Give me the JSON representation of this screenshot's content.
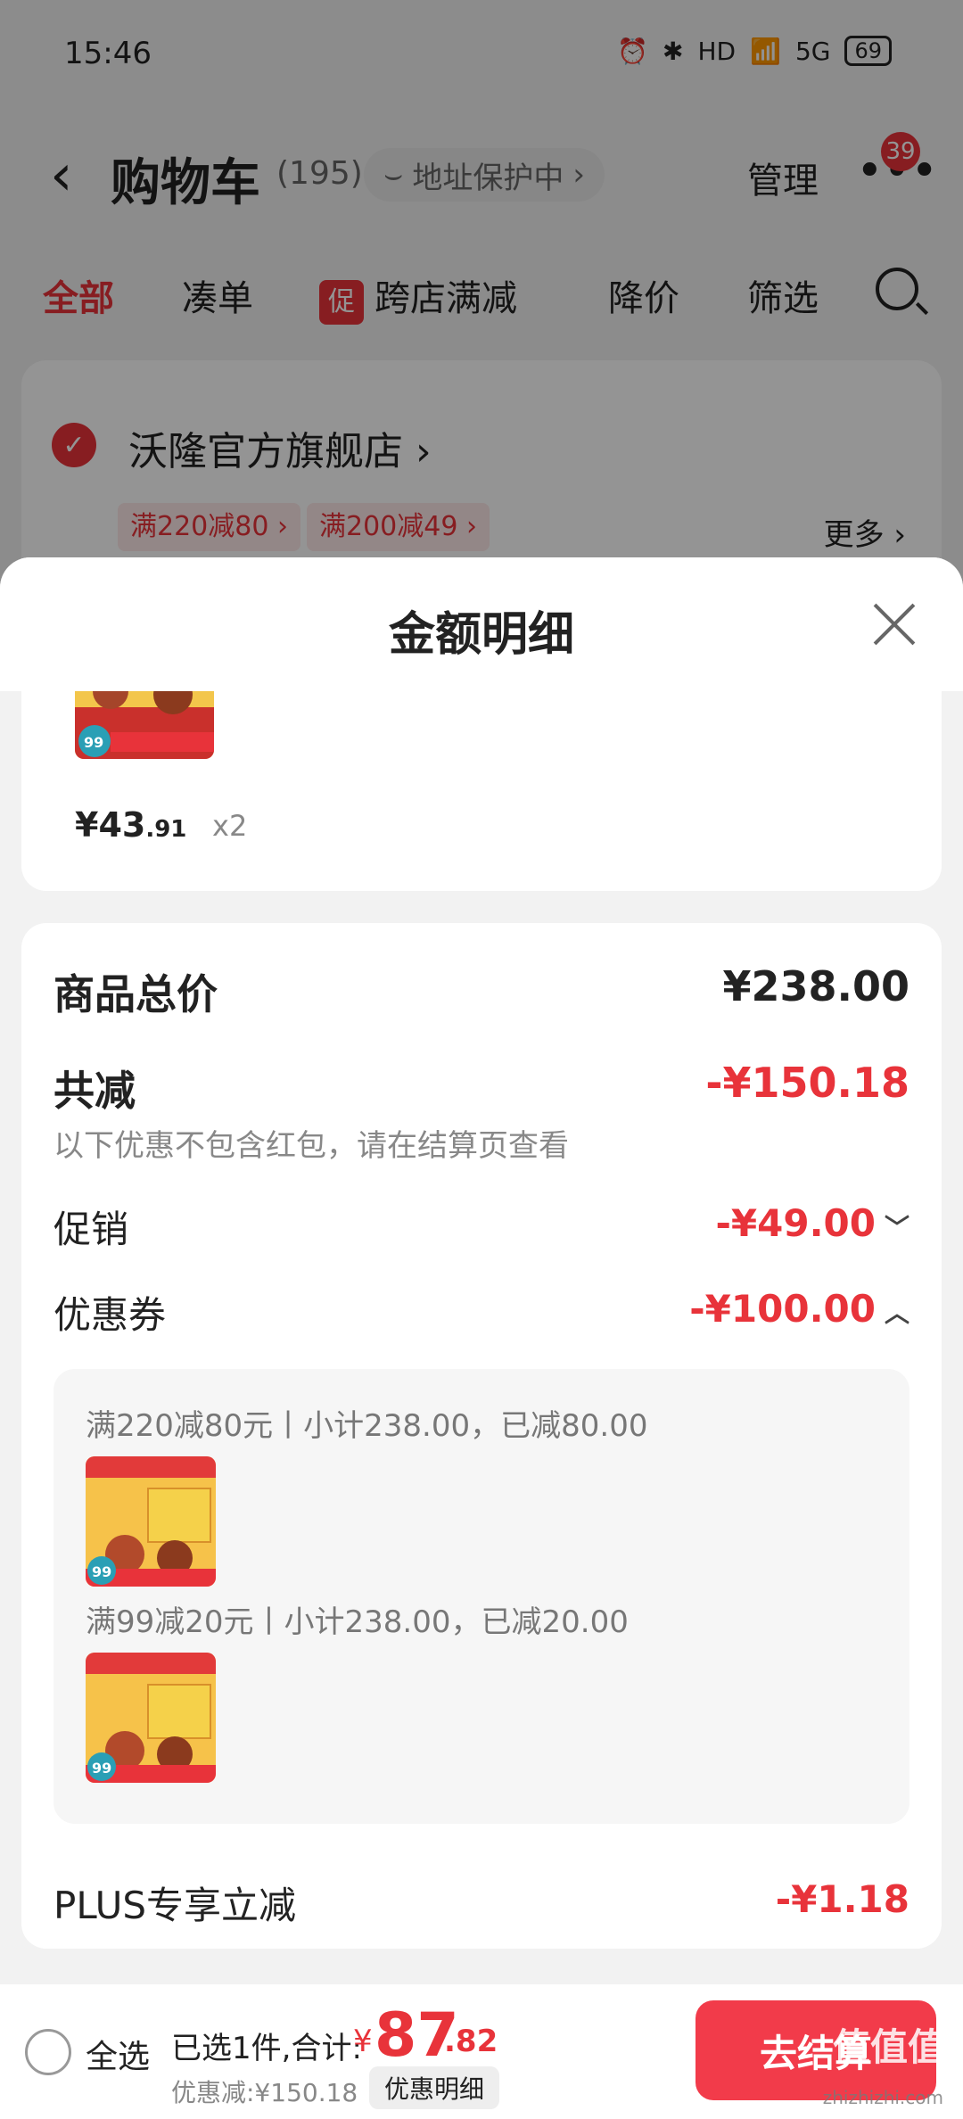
{
  "status_bar": {
    "time": "15:46",
    "icons": [
      "alarm-icon",
      "bluetooth-icon",
      "hd-icon",
      "wifi-icon",
      "signal-icon"
    ],
    "network": "5G",
    "battery": "69"
  },
  "nav": {
    "title": "购物车",
    "count": "(195)",
    "address_protect": "地址保护中",
    "manage": "管理",
    "badge": "39"
  },
  "tabs": [
    {
      "label": "全部",
      "active": true
    },
    {
      "label": "凑单"
    },
    {
      "label": "跨店满减",
      "tag": "促"
    },
    {
      "label": "降价"
    },
    {
      "label": "筛选"
    }
  ],
  "store": {
    "name": "沃隆官方旗舰店",
    "coupons": [
      "满220减80",
      "满200减49"
    ],
    "more": "更多"
  },
  "sheet": {
    "title": "金额明细",
    "item": {
      "price_main": "¥43",
      "price_dec": ".91",
      "qty": "x2"
    },
    "summary": {
      "total_label": "商品总价",
      "total_value": "¥238.00",
      "reduce_label": "共减",
      "reduce_value": "-¥150.18",
      "reduce_note": "以下优惠不包含红包，请在结算页查看",
      "promo_label": "促销",
      "promo_value": "-¥49.00",
      "coupon_label": "优惠券",
      "coupon_value": "-¥100.00",
      "coupon_lines": [
        "满220减80元丨小计238.00，已减80.00",
        "满99减20元丨小计238.00，已减20.00"
      ],
      "plus_label": "PLUS专享立减",
      "plus_value": "-¥1.18"
    }
  },
  "bottom_bar": {
    "select_all": "全选",
    "selected_text": "已选1件,合计:",
    "currency": "¥",
    "total_int": "87",
    "total_dec": ".82",
    "discount": "优惠减:¥150.18",
    "detail_button": "优惠明细",
    "checkout_button": "去结算"
  },
  "colors": {
    "accent": "#e8333a",
    "checkout": "#f23b4a"
  }
}
